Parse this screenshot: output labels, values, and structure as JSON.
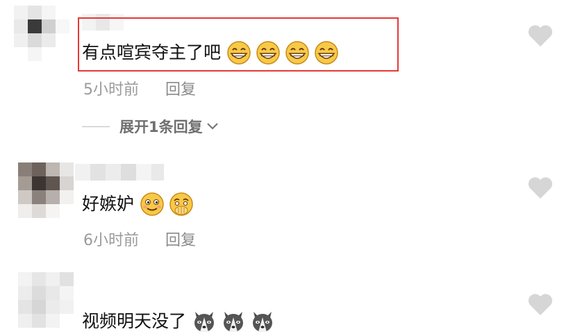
{
  "comments": [
    {
      "text": "有点喧宾夺主了吧",
      "emojis": [
        "grin-emoji",
        "grin-emoji",
        "grin-emoji",
        "grin-emoji"
      ],
      "time": "5小时前",
      "reply_label": "回复",
      "liked": false
    },
    {
      "text": "好嫉妒",
      "emojis": [
        "smile-emoji",
        "cover-mouth-emoji"
      ],
      "time": "6小时前",
      "reply_label": "回复",
      "liked": false
    },
    {
      "text": "视频明天没了",
      "emojis": [
        "husky-emoji",
        "husky-emoji",
        "husky-emoji"
      ],
      "liked": false
    }
  ],
  "expand_replies": {
    "label": "展开1条回复"
  },
  "colors": {
    "highlight": "#e53935",
    "heart": "#d6d6d6",
    "meta_text": "#9a9a9a",
    "emoji_yellow": "#f7c948"
  }
}
